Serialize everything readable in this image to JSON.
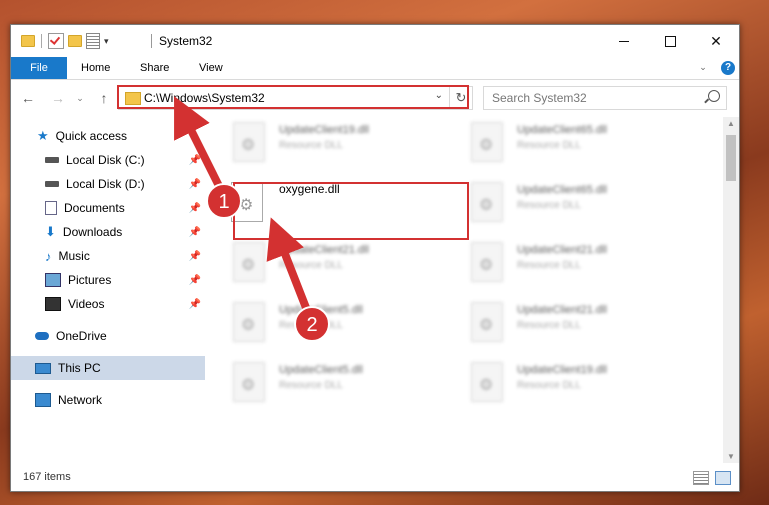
{
  "window": {
    "title": "System32",
    "controls": {
      "minimize": "",
      "maximize": "",
      "close": "✕"
    }
  },
  "ribbon": {
    "tabs": [
      "File",
      "Home",
      "Share",
      "View"
    ],
    "help": "?"
  },
  "nav": {
    "back": "←",
    "forward": "→",
    "recent": "⌄",
    "up": "↑",
    "address": "C:\\Windows\\System32",
    "address_dropdown": "⌄",
    "refresh": "↻",
    "search_placeholder": "Search System32"
  },
  "sidebar": {
    "items": [
      {
        "label": "Quick access",
        "icon": "star-icon",
        "pinned": false
      },
      {
        "label": "Local Disk (C:)",
        "icon": "disk-icon",
        "pinned": true
      },
      {
        "label": "Local Disk (D:)",
        "icon": "disk-icon",
        "pinned": true
      },
      {
        "label": "Documents",
        "icon": "document-icon",
        "pinned": true
      },
      {
        "label": "Downloads",
        "icon": "download-icon",
        "pinned": true
      },
      {
        "label": "Music",
        "icon": "music-icon",
        "pinned": true
      },
      {
        "label": "Pictures",
        "icon": "pictures-icon",
        "pinned": true
      },
      {
        "label": "Videos",
        "icon": "videos-icon",
        "pinned": true
      },
      {
        "label": "OneDrive",
        "icon": "cloud-icon",
        "pinned": false
      },
      {
        "label": "This PC",
        "icon": "computer-icon",
        "pinned": false,
        "selected": true
      },
      {
        "label": "Network",
        "icon": "network-icon",
        "pinned": false
      }
    ]
  },
  "files": [
    {
      "name": "UpdateClient19.dll",
      "type": "Resource DLL"
    },
    {
      "name": "UpdateClient65.dll",
      "type": "Resource DLL"
    },
    {
      "name": "oxygene.dll",
      "type": ""
    },
    {
      "name": "UpdateClient65.dll",
      "type": "Resource DLL"
    },
    {
      "name": "UpdateClient21.dll",
      "type": "Resource DLL"
    },
    {
      "name": "UpdateClient21.dll",
      "type": "Resource DLL"
    },
    {
      "name": "UpdateClient5.dll",
      "type": "Resource DLL"
    },
    {
      "name": "UpdateClient21.dll",
      "type": "Resource DLL"
    },
    {
      "name": "UpdateClient5.dll",
      "type": "Resource DLL"
    },
    {
      "name": "UpdateClient19.dll",
      "type": "Resource DLL"
    }
  ],
  "status": {
    "count": "167 items"
  },
  "annotations": {
    "step1": "1",
    "step2": "2",
    "color": "#d33131"
  }
}
